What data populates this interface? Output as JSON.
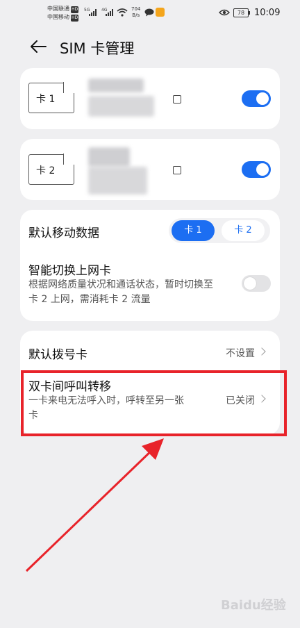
{
  "status_bar": {
    "carrier1": "中国联通",
    "carrier2": "中国移动",
    "hd": "HD",
    "net_5g": "5G",
    "net_4g": "4G",
    "speed_value": "704",
    "speed_unit": "B/s",
    "battery": "78",
    "time": "10:09"
  },
  "header": {
    "back_icon": "arrow-left-icon",
    "title": "SIM 卡管理"
  },
  "sim_cards": [
    {
      "label": "卡 1",
      "enabled": true
    },
    {
      "label": "卡 2",
      "enabled": true
    }
  ],
  "data_settings": {
    "default_data_label": "默认移动数据",
    "options": [
      "卡 1",
      "卡 2"
    ],
    "selected": "卡 1",
    "smart_switch_label": "智能切换上网卡",
    "smart_switch_desc": "根据网络质量状况和通话状态，暂时切换至卡 2 上网，需消耗卡 2 流量",
    "smart_switch_enabled": false
  },
  "call_settings": {
    "default_dial_label": "默认拨号卡",
    "default_dial_value": "不设置",
    "forward_label": "双卡间呼叫转移",
    "forward_desc": "一卡来电无法呼入时，呼转至另一张卡",
    "forward_value": "已关闭"
  },
  "annotation_color": "#e8232a",
  "accent_color": "#1c6ef2",
  "watermark": "Baidu经验"
}
